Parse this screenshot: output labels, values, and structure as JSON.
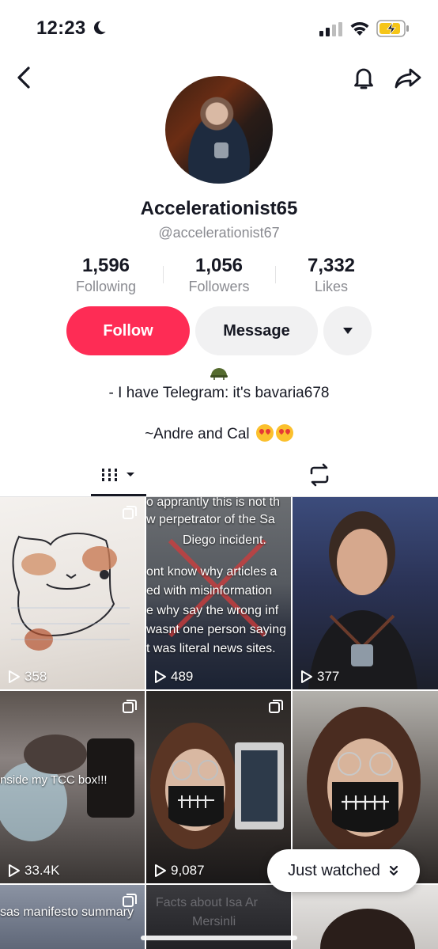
{
  "status_bar": {
    "time": "12:23"
  },
  "profile": {
    "display_name": "Accelerationist65",
    "username": "@accelerationist67",
    "stats": {
      "following_count": "1,596",
      "following_label": "Following",
      "followers_count": "1,056",
      "followers_label": "Followers",
      "likes_count": "7,332",
      "likes_label": "Likes"
    },
    "actions": {
      "follow_label": "Follow",
      "message_label": "Message"
    },
    "bio": {
      "line1": "- I have Telegram: it's bavaria678",
      "line2": "~Andre and Cal"
    }
  },
  "tabs": [
    {
      "name": "videos",
      "icon": "grid-icon",
      "active": true
    },
    {
      "name": "reposts",
      "icon": "repost-icon",
      "active": false
    }
  ],
  "videos": [
    {
      "views": "358"
    },
    {
      "views": "489",
      "overlay_lines": [
        "o apprantly this is not th",
        "w perpetrator of the Sa",
        "Diego incident.",
        "",
        "ont know why articles a",
        "ed with misinformation",
        "e why say the wrong inf",
        "wasnt one person saying",
        "t was literal news sites."
      ]
    },
    {
      "views": "377"
    },
    {
      "views": "33.4K",
      "overlay": "nside my TCC box!!!"
    },
    {
      "views": "9,087"
    },
    {
      "views": ""
    },
    {
      "overlay": "sas manifesto summary"
    },
    {
      "overlay_lines": [
        "Facts about Isa Ar",
        "Mersinli"
      ]
    },
    {}
  ],
  "just_watched_label": "Just watched",
  "colors": {
    "follow_button": "#fe2c55",
    "secondary_button": "#f1f1f2",
    "muted_text": "#8a8b91"
  }
}
